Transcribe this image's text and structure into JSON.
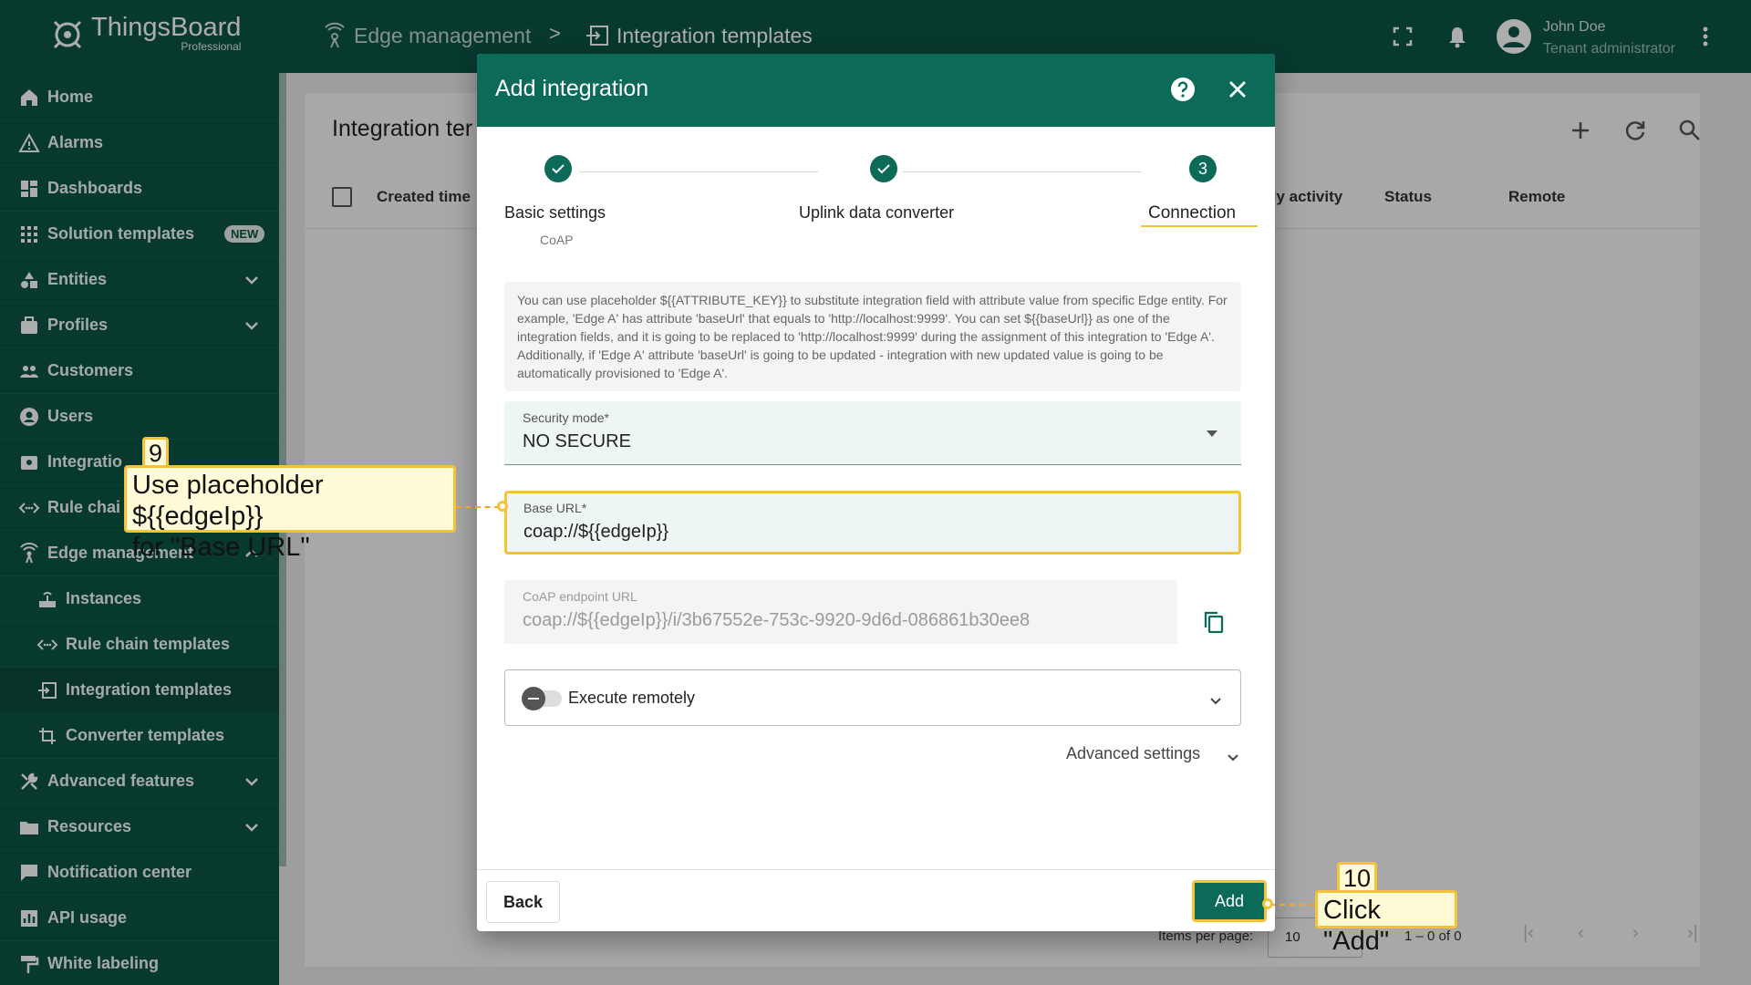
{
  "app": {
    "logo_title": "ThingsBoard",
    "logo_sub": "Professional"
  },
  "breadcrumb": {
    "first": "Edge management",
    "separator": ">",
    "second": "Integration templates"
  },
  "user": {
    "name": "John Doe",
    "role": "Tenant administrator"
  },
  "sidebar": {
    "items": [
      {
        "label": "Home",
        "icon": "home-icon"
      },
      {
        "label": "Alarms",
        "icon": "alarm-icon"
      },
      {
        "label": "Dashboards",
        "icon": "dashboard-icon"
      },
      {
        "label": "Solution templates",
        "icon": "apps-icon",
        "badge": "NEW"
      },
      {
        "label": "Entities",
        "icon": "entities-icon"
      },
      {
        "label": "Profiles",
        "icon": "profiles-icon"
      },
      {
        "label": "Customers",
        "icon": "customers-icon"
      },
      {
        "label": "Users",
        "icon": "users-icon"
      },
      {
        "label": "Integratio",
        "icon": "integration-icon"
      },
      {
        "label": "Rule chai",
        "icon": "rule-chain-icon"
      },
      {
        "label": "Edge management",
        "icon": "edge-icon"
      },
      {
        "label": "Instances",
        "icon": "instances-icon"
      },
      {
        "label": "Rule chain templates",
        "icon": "rule-chain-icon"
      },
      {
        "label": "Integration templates",
        "icon": "integration-icon"
      },
      {
        "label": "Converter templates",
        "icon": "converter-icon"
      },
      {
        "label": "Advanced features",
        "icon": "tools-icon"
      },
      {
        "label": "Resources",
        "icon": "folder-icon"
      },
      {
        "label": "Notification center",
        "icon": "notification-icon"
      },
      {
        "label": "API usage",
        "icon": "api-icon"
      },
      {
        "label": "White labeling",
        "icon": "paint-icon"
      }
    ]
  },
  "background_page": {
    "title": "Integration ter",
    "columns": [
      "Created time",
      "ily activity",
      "Status",
      "Remote"
    ],
    "items_per_page_label": "Items per page:",
    "items_per_page": "10",
    "range": "1 – 0 of 0"
  },
  "dialog": {
    "title": "Add integration",
    "steps": [
      {
        "label": "Basic settings",
        "sub": "CoAP",
        "state": "done"
      },
      {
        "label": "Uplink data converter",
        "state": "done"
      },
      {
        "label": "Connection",
        "number": "3",
        "state": "active"
      }
    ],
    "hint": "You can use placeholder ${{ATTRIBUTE_KEY}} to substitute integration field with attribute value from specific Edge entity. For example, 'Edge A' has attribute 'baseUrl' that equals to 'http://localhost:9999'. You can set ${{baseUrl}} as one of the integration fields, and it is going to be replaced to 'http://localhost:9999' during the assignment of this integration to 'Edge A'. Additionally, if 'Edge A' attribute 'baseUrl' is going to be updated - integration with new updated value is going to be automatically provisioned to 'Edge A'.",
    "security_mode_label": "Security mode*",
    "security_mode_value": "NO SECURE",
    "base_url_label": "Base URL*",
    "base_url_value": "coap://${{edgeIp}}",
    "endpoint_label": "CoAP endpoint URL",
    "endpoint_value": "coap://${{edgeIp}}/i/3b67552e-753c-9920-9d6d-086861b30ee8",
    "execute_remotely": "Execute remotely",
    "advanced_settings": "Advanced settings",
    "back_label": "Back",
    "add_label": "Add"
  },
  "annotations": {
    "step9_num": "9",
    "step9_line1": "Use placeholder ${{edgeIp}}",
    "step9_line2": "for  \"Base URL\"",
    "step10_num": "10",
    "step10_text": "Click \"Add\""
  },
  "colors": {
    "primary": "#0b5446",
    "dialog_header": "#0b6a58",
    "highlight": "#f5c238"
  }
}
